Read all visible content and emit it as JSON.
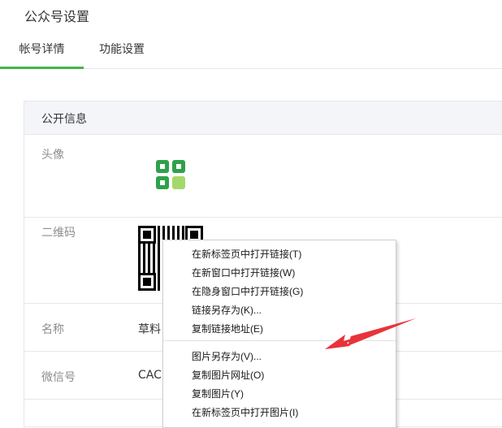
{
  "page": {
    "title": "公众号设置"
  },
  "tabs": [
    {
      "label": "帐号详情"
    },
    {
      "label": "功能设置"
    }
  ],
  "info": {
    "header": "公开信息",
    "rows": {
      "avatar": {
        "label": "头像"
      },
      "qrcode": {
        "label": "二维码"
      },
      "name": {
        "label": "名称",
        "value": "草料"
      },
      "wechat_id": {
        "label": "微信号",
        "value": "CAC"
      }
    }
  },
  "context_menu": {
    "items": [
      "在新标签页中打开链接(T)",
      "在新窗口中打开链接(W)",
      "在隐身窗口中打开链接(G)",
      "链接另存为(K)...",
      "复制链接地址(E)",
      "图片另存为(V)...",
      "复制图片网址(O)",
      "复制图片(Y)",
      "在新标签页中打开图片(I)"
    ]
  },
  "colors": {
    "accent": "#44b549",
    "arrow": "#e8333a",
    "logo_dark": "#2fa14a",
    "logo_light": "#a5d86a"
  },
  "icons": {
    "avatar": "clover-logo-icon",
    "arrow": "red-arrow-annotation"
  }
}
